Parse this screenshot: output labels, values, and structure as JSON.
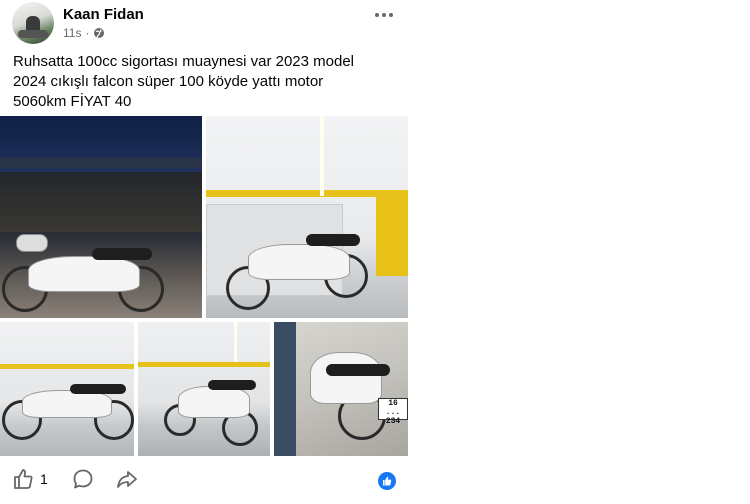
{
  "post": {
    "author": "Kaan Fidan",
    "time": "11s",
    "separator": "·",
    "more_icon": "more-horizontal-icon",
    "text": "Ruhsatta 100cc sigortası muaynesi var 2023 model\n2024 cıkışlı falcon süper 100 köyde yattı motor\n5060km FİYAT 40",
    "photos": [
      {
        "alt": "motorcycle at night by the sea"
      },
      {
        "alt": "motorcycle in garage"
      },
      {
        "alt": "motorcycle side view"
      },
      {
        "alt": "motorcycle front angle"
      },
      {
        "alt": "motorcycle rear with plate"
      }
    ],
    "plate_text": "16 ...\n234"
  },
  "actions": {
    "like_count": "1",
    "like_icon": "thumbs-up-icon",
    "comment_icon": "comment-bubble-icon",
    "share_icon": "share-arrow-icon",
    "reaction_icon": "like-reaction-icon"
  },
  "colors": {
    "brand_blue": "#1877f2",
    "secondary_text": "#65676b"
  }
}
